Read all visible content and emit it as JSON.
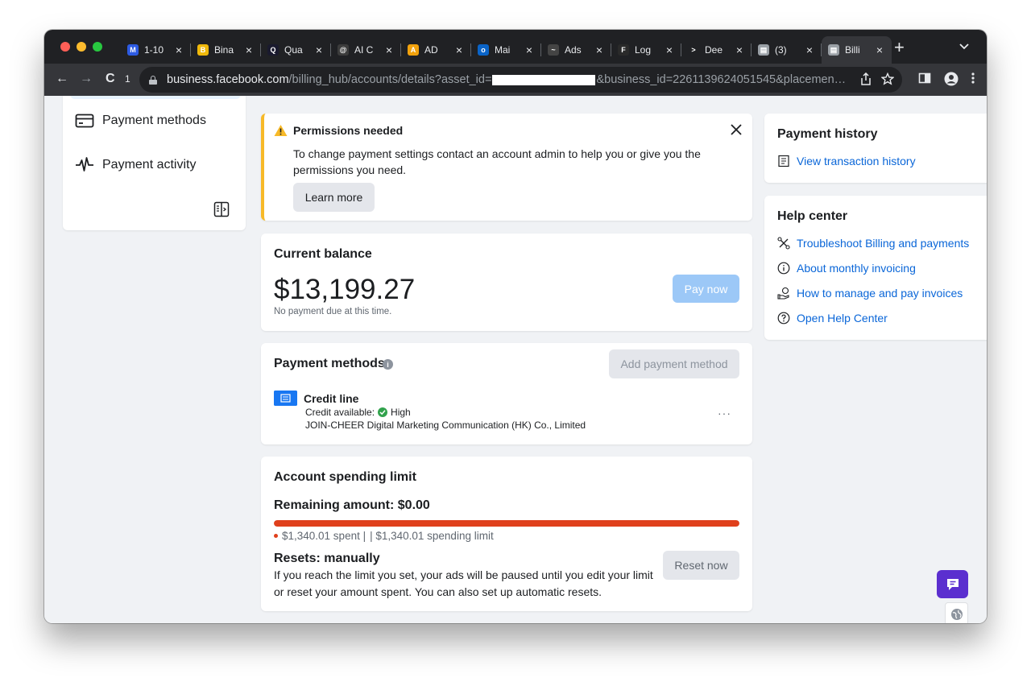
{
  "browser": {
    "tabs": [
      {
        "label": "1-10",
        "fav_color": "#2d5be3",
        "fav_glyph": "M",
        "active": false
      },
      {
        "label": "Bina",
        "fav_color": "#f0b90b",
        "fav_glyph": "B",
        "active": false
      },
      {
        "label": "Qua",
        "fav_color": "#1a1a2e",
        "fav_glyph": "Q",
        "active": false
      },
      {
        "label": "AI C",
        "fav_color": "#3c3c3c",
        "fav_glyph": "@",
        "active": false
      },
      {
        "label": "AD",
        "fav_color": "#f2a20d",
        "fav_glyph": "A",
        "active": false
      },
      {
        "label": "Mai",
        "fav_color": "#0a64c8",
        "fav_glyph": "o",
        "active": false
      },
      {
        "label": "Ads",
        "fav_color": "#444444",
        "fav_glyph": "~",
        "active": false
      },
      {
        "label": "Log",
        "fav_color": "#2a2a2a",
        "fav_glyph": "F",
        "active": false
      },
      {
        "label": "Dee",
        "fav_color": "#202124",
        "fav_glyph": ">",
        "active": false
      },
      {
        "label": "(3)",
        "fav_color": "#9aa0a6",
        "fav_glyph": "▤",
        "active": false
      },
      {
        "label": "Billi",
        "fav_color": "#9aa0a6",
        "fav_glyph": "▤",
        "active": true
      }
    ],
    "new_tab": "+",
    "tab_list": "⌄",
    "nav": {
      "back": "←",
      "forward": "→",
      "reload": "C",
      "reload_badge": "1"
    },
    "url_host": "business.facebook.com",
    "url_path_a": "/billing_hub/accounts/details?asset_id=",
    "url_path_b": "&business_id=2261139624051545&placemen…"
  },
  "sidebar": {
    "items": [
      {
        "label": "Payment methods",
        "icon": "card-icon"
      },
      {
        "label": "Payment activity",
        "icon": "activity-icon"
      }
    ],
    "toggle_icon": "collapse-panel-icon"
  },
  "notice": {
    "title": "Permissions needed",
    "body": "To change payment settings contact an account admin to help you or give you the permissions you need.",
    "learn_more": "Learn more",
    "accent": "#f7b928"
  },
  "balance": {
    "title": "Current balance",
    "amount": "$13,199.27",
    "note": "No payment due at this time.",
    "pay_now": "Pay now"
  },
  "payment_methods": {
    "title": "Payment methods",
    "info": "i",
    "add_button": "Add payment method",
    "method": {
      "name": "Credit line",
      "available_label": "Credit available:",
      "available_value": "High",
      "company": "JOIN-CHEER Digital Marketing Communication (HK) Co., Limited",
      "more": "···"
    }
  },
  "spending_limit": {
    "title": "Account spending limit",
    "remaining": "Remaining amount: $0.00",
    "spent_fraction": 1.0,
    "spent_text": "$1,340.01 spent |",
    "limit_text": "| $1,340.01 spending limit",
    "resets_title": "Resets: manually",
    "resets_body": "If you reach the limit you set, your ads will be paused until you edit your limit or reset your amount spent. You can also set up automatic resets.",
    "reset_button": "Reset now",
    "bar_color": "#e0401c"
  },
  "payment_history": {
    "title": "Payment history",
    "link": "View transaction history"
  },
  "help_center": {
    "title": "Help center",
    "links": [
      {
        "label": "Troubleshoot Billing and payments",
        "icon": "tools-icon"
      },
      {
        "label": "About monthly invoicing",
        "icon": "info-circle-icon"
      },
      {
        "label": "How to manage and pay invoices",
        "icon": "hand-money-icon"
      },
      {
        "label": "Open Help Center",
        "icon": "question-circle-icon"
      }
    ]
  },
  "colors": {
    "link": "#0a66d8",
    "primary_disabled": "#9cc8f7",
    "chat": "#5b2fcf"
  }
}
